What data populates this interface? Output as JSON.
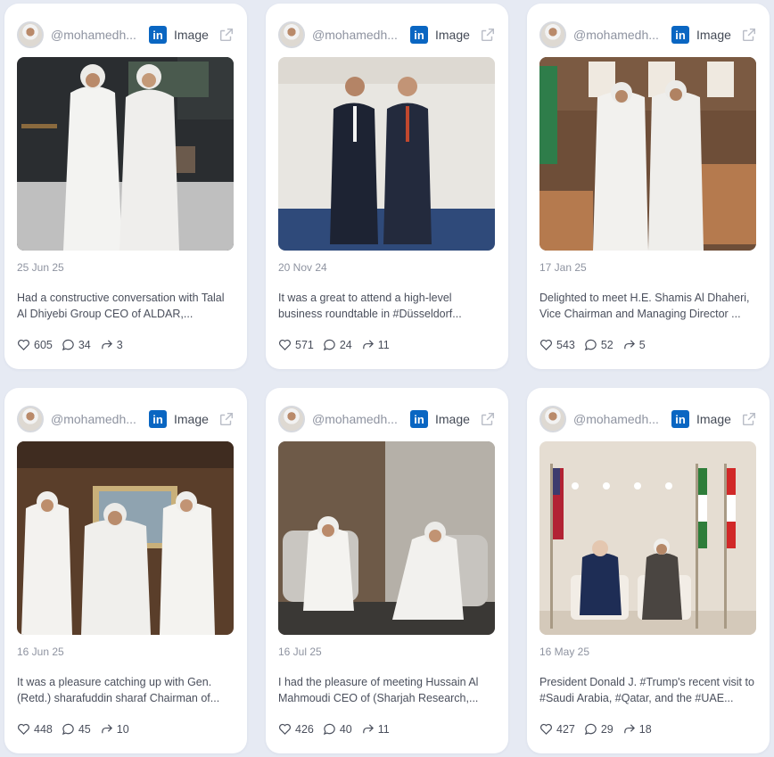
{
  "colors": {
    "background": "#e6eaf3",
    "card": "#ffffff",
    "linkedin": "#0a66c2",
    "muted": "#8e93a0"
  },
  "posts": [
    {
      "handle": "@mohamedh...",
      "network_icon": "linkedin-icon",
      "type": "Image",
      "date": "25 Jun 25",
      "text": "Had a constructive conversation with Talal Al Dhiyebi Group CEO of ALDAR,...",
      "likes": "605",
      "comments": "34",
      "shares": "3"
    },
    {
      "handle": "@mohamedh...",
      "network_icon": "linkedin-icon",
      "type": "Image",
      "date": "20 Nov 24",
      "text": "It was a great to attend a high-level business roundtable in #Düsseldorf...",
      "likes": "571",
      "comments": "24",
      "shares": "11"
    },
    {
      "handle": "@mohamedh...",
      "network_icon": "linkedin-icon",
      "type": "Image",
      "date": "17 Jan 25",
      "text": "Delighted to meet H.E. Shamis Al Dhaheri, Vice Chairman and Managing Director ...",
      "likes": "543",
      "comments": "52",
      "shares": "5"
    },
    {
      "handle": "@mohamedh...",
      "network_icon": "linkedin-icon",
      "type": "Image",
      "date": "16 Jun 25",
      "text": "It was a pleasure catching up with Gen. (Retd.) sharafuddin sharaf Chairman of...",
      "likes": "448",
      "comments": "45",
      "shares": "10"
    },
    {
      "handle": "@mohamedh...",
      "network_icon": "linkedin-icon",
      "type": "Image",
      "date": "16 Jul 25",
      "text": "I had the pleasure of meeting Hussain Al Mahmoudi CEO of (Sharjah Research,...",
      "likes": "426",
      "comments": "40",
      "shares": "11"
    },
    {
      "handle": "@mohamedh...",
      "network_icon": "linkedin-icon",
      "type": "Image",
      "date": "16 May 25",
      "text": "President Donald J. #Trump's recent visit to #Saudi Arabia, #Qatar, and the #UAE...",
      "likes": "427",
      "comments": "29",
      "shares": "18"
    }
  ]
}
